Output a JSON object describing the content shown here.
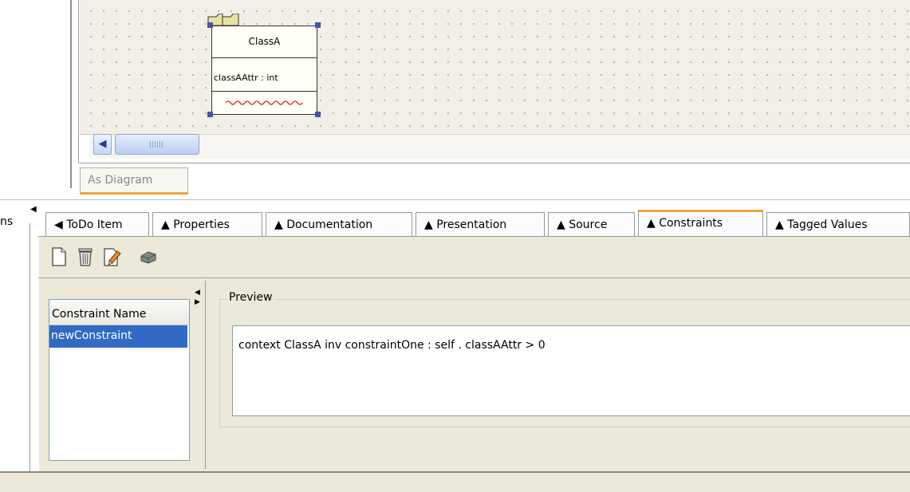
{
  "diagram": {
    "class": {
      "name": "ClassA",
      "attribute": "classAAttr : int"
    },
    "scroll_left_glyph": "◀",
    "tab_label": "As Diagram"
  },
  "details": {
    "collapsed_panel_label": "ns",
    "tabs": [
      {
        "label": "◀ ToDo Item",
        "active": false
      },
      {
        "label": "▲ Properties",
        "active": false
      },
      {
        "label": "▲ Documentation",
        "active": false
      },
      {
        "label": "▲ Presentation",
        "active": false
      },
      {
        "label": "▲ Source",
        "active": false
      },
      {
        "label": "▲ Constraints",
        "active": true
      },
      {
        "label": "▲ Tagged Values",
        "active": false
      }
    ],
    "toolbar": [
      {
        "icon": "new-document-icon"
      },
      {
        "icon": "trash-icon"
      },
      {
        "icon": "edit-icon"
      },
      {
        "icon": "cube-icon"
      }
    ],
    "constraints": {
      "list_header": "Constraint Name",
      "items": [
        "newConstraint"
      ],
      "selected_index": 0,
      "preview_label": "Preview",
      "preview_text": "context ClassA inv constraintOne : self . classAAttr > 0"
    }
  },
  "colors": {
    "active_tab_accent": "#f0a33c",
    "selection": "#316ac5",
    "panel_background": "#ece9d8",
    "diagram_background": "#f1efe7",
    "wavy_underline": "#e02020"
  }
}
